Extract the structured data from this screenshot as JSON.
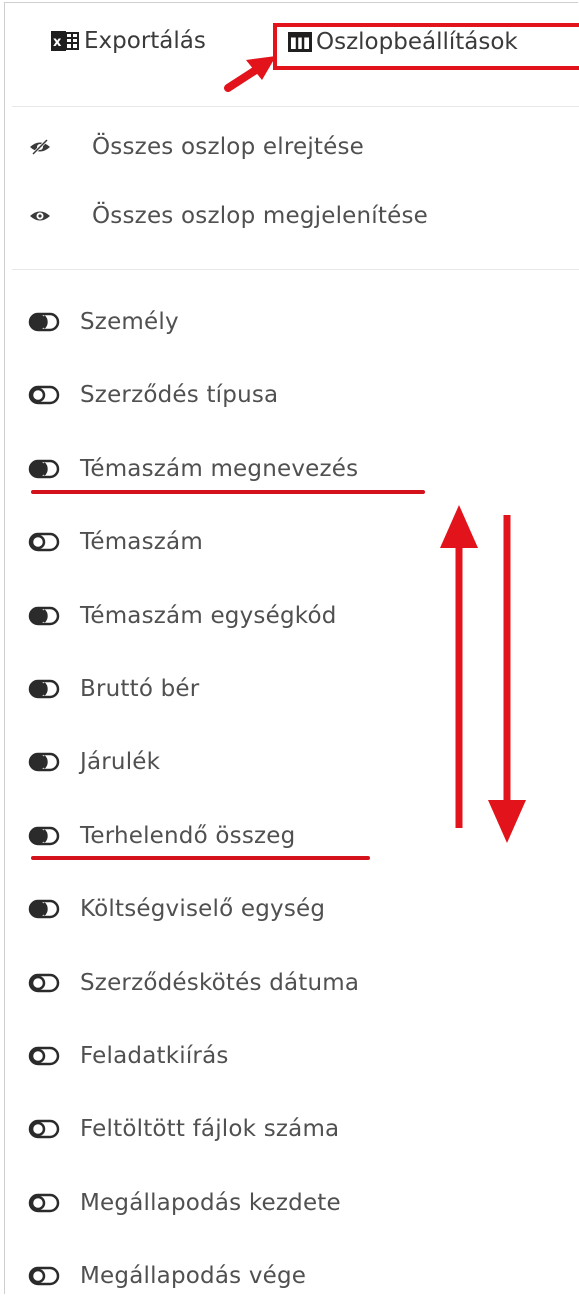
{
  "toolbar": {
    "export_label": "Exportálás",
    "columns_label": "Oszlopbeállítások"
  },
  "visibility": {
    "hide_all": "Összes oszlop elrejtése",
    "show_all": "Összes oszlop megjelenítése"
  },
  "columns": [
    {
      "label": "Személy",
      "enabled": true
    },
    {
      "label": "Szerződés típusa",
      "enabled": false
    },
    {
      "label": "Témaszám megnevezés",
      "enabled": true
    },
    {
      "label": "Témaszám",
      "enabled": false
    },
    {
      "label": "Témaszám egységkód",
      "enabled": true
    },
    {
      "label": "Bruttó bér",
      "enabled": true
    },
    {
      "label": "Járulék",
      "enabled": true
    },
    {
      "label": "Terhelendő összeg",
      "enabled": true
    },
    {
      "label": "Költségviselő egység",
      "enabled": true
    },
    {
      "label": "Szerződéskötés dátuma",
      "enabled": false
    },
    {
      "label": "Feladatkiírás",
      "enabled": false
    },
    {
      "label": "Feltöltött fájlok száma",
      "enabled": false
    },
    {
      "label": "Megállapodás kezdete",
      "enabled": false
    },
    {
      "label": "Megállapodás vége",
      "enabled": false
    }
  ],
  "colors": {
    "annotation": "#e2131b",
    "toggle": "#2b2b2b",
    "text": "#505050"
  },
  "icons": {
    "export": "excel-icon",
    "columns": "table-columns-icon",
    "hide_all": "eye-slash-icon",
    "show_all": "eye-icon",
    "toggle_on": "toggle-on-icon",
    "toggle_off": "toggle-off-icon"
  }
}
